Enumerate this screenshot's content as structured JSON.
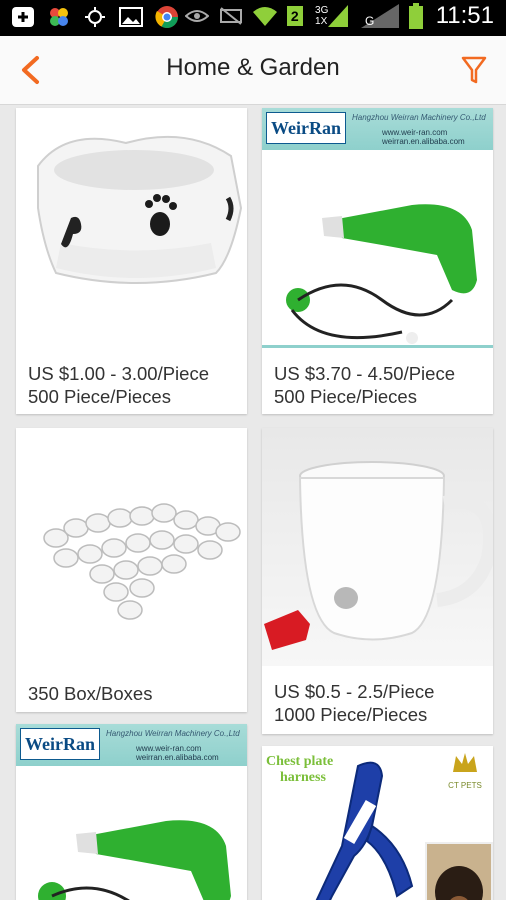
{
  "status_bar": {
    "time": "11:51",
    "network": "3G",
    "network_sub": "1X",
    "sim": "2",
    "carrier_letter": "G"
  },
  "app_bar": {
    "title": "Home & Garden",
    "back_icon": "back-arrow-icon",
    "filter_icon": "filter-funnel-icon",
    "accent": "#f26a21"
  },
  "products": [
    {
      "price": "US $1.00 - 3.00/Piece",
      "moq": "500 Piece/Pieces",
      "image": "dog-bowl"
    },
    {
      "price": "US $3.70 - 4.50/Piece",
      "moq": "500 Piece/Pieces",
      "image": "green-sprayer",
      "banner": {
        "logo": "WeirRan",
        "company": "Hangzhou Weirran Machinery Co.,Ltd",
        "url1": "www.weir-ran.com",
        "url2": "weirran.en.alibaba.com"
      }
    },
    {
      "price": "",
      "moq": "350 Box/Boxes",
      "image": "white-tablets"
    },
    {
      "price": "US $0.5 - 2.5/Piece",
      "moq": "1000 Piece/Pieces",
      "image": "white-mug"
    },
    {
      "price": "",
      "moq": "",
      "image": "green-sprayer",
      "banner": {
        "logo": "WeirRan",
        "company": "Hangzhou Weirran Machinery Co.,Ltd",
        "url1": "www.weir-ran.com",
        "url2": "weirran.en.alibaba.com"
      }
    },
    {
      "price": "",
      "moq": "",
      "image": "dog-harness",
      "overlay": {
        "line1": "Chest plate",
        "line2": "harness",
        "brand": "CT PETS"
      }
    }
  ]
}
